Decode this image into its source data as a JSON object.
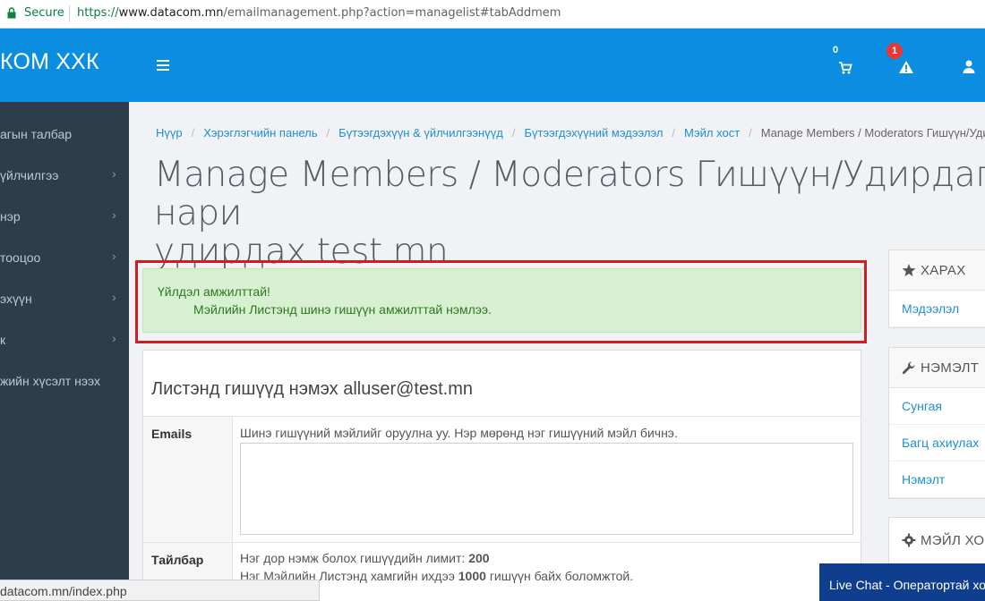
{
  "browser": {
    "secure_label": "Secure",
    "url_scheme": "https://",
    "url_host": "www.datacom.mn",
    "url_path": "/emailmanagement.php?action=managelist#tabAddmem"
  },
  "header": {
    "brand": "КОМ ХХК",
    "cart_count": "0",
    "alert_count": "1",
    "accent_color": "#0c8ee0"
  },
  "sidebar": {
    "items": [
      {
        "label": "агын талбар",
        "has_chevron": false
      },
      {
        "label": "үйлчилгээ",
        "has_chevron": true
      },
      {
        "label": "нэр",
        "has_chevron": true
      },
      {
        "label": "тооцоо",
        "has_chevron": true
      },
      {
        "label": "эхүүн",
        "has_chevron": true
      },
      {
        "label": "к",
        "has_chevron": true
      },
      {
        "label": "жийн хүсэлт нээх",
        "has_chevron": false
      }
    ]
  },
  "breadcrumb": {
    "items": [
      "Нүүр",
      "Хэрэглэгчийн панель",
      "Бүтээгдэхүүн & үйлчилгээнүүд",
      "Бүтээгдэхүүний мэдээлэл",
      "Мэйл хост"
    ],
    "current": "Manage Members / Moderators Гишүүн/Удирдаг"
  },
  "page": {
    "title_line1": "Manage Members / Moderators Гишүүн/Удирдагч нари",
    "title_line2": "удирдах test.mn"
  },
  "alert": {
    "title": "Үйлдэл амжилттай!",
    "message": "Мэйлийн Листэнд шинэ гишүүн амжилттай нэмлээ."
  },
  "panel": {
    "title": "Листэнд гишүүд нэмэх alluser@test.mn",
    "emails_label": "Emails",
    "emails_help": "Шинэ гишүүний мэйлийг оруулна уу. Нэр мөрөнд нэг гишүүний мэйл бичнэ.",
    "emails_value": "",
    "note_label": "Тайлбар",
    "note_line1_prefix": "Нэг дор нэмж болох гишүүдийн лимит:",
    "note_line1_value": "200",
    "note_line2_prefix": "Нэг Мэйлийн Листэнд хамгийн ихдээ",
    "note_line2_value": "1000",
    "note_line2_suffix": "гишүүн байх боломжтой."
  },
  "right": {
    "view_header": "ХАРАХ",
    "view_items": [
      "Мэдээлэл"
    ],
    "extra_header": "НЭМЭЛТ",
    "extra_items": [
      "Сунгая",
      "Багц ахиулах",
      "Нэмэлт"
    ],
    "mail_header": "МЭЙЛ ХОС"
  },
  "statusbar": {
    "text": "datacom.mn/index.php"
  },
  "livechat": {
    "label": "Live Chat - Оператортай хол"
  }
}
